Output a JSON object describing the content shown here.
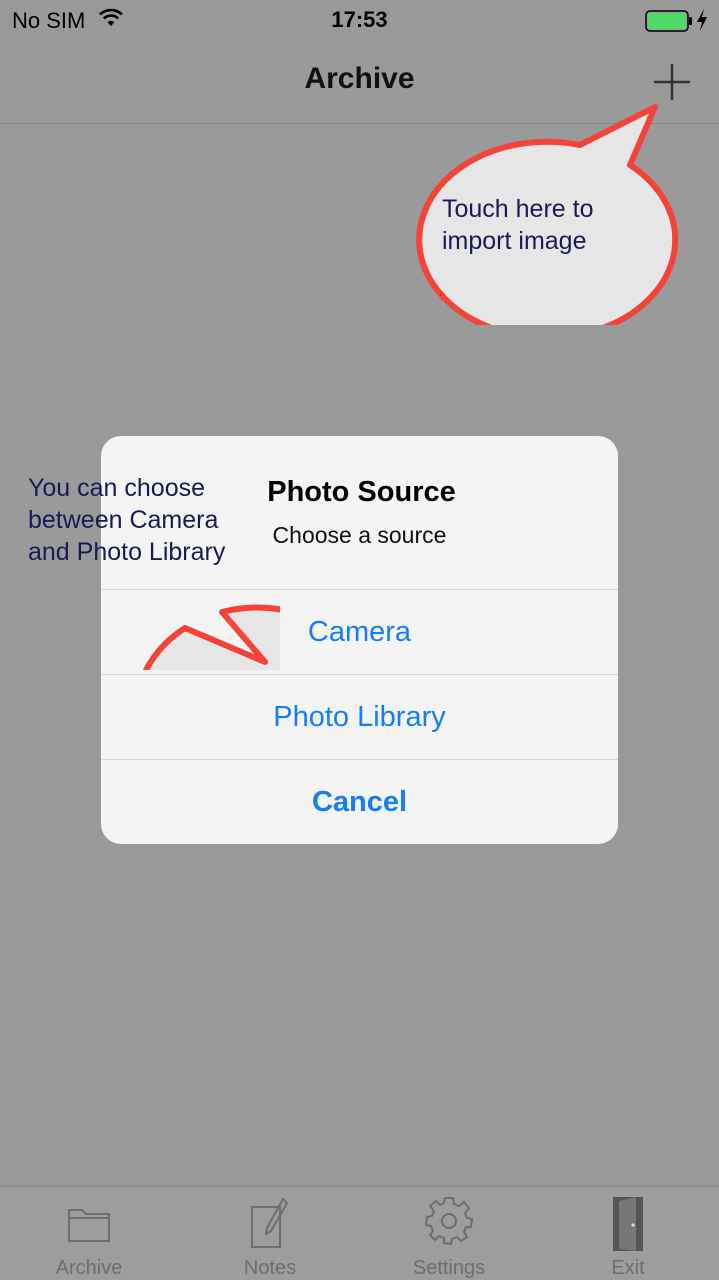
{
  "status_bar": {
    "carrier": "No SIM",
    "time": "17:53",
    "wifi_icon": "wifi-icon",
    "battery_icon": "battery-charging-icon",
    "battery_color": "#4cd964"
  },
  "nav": {
    "title": "Archive",
    "add_icon": "plus-icon"
  },
  "callouts": {
    "import_hint": "Touch here to import image",
    "source_hint": "You can choose between Camera and Photo Library",
    "border_color": "#f5433a",
    "fill_color": "#e6e6e6"
  },
  "alert": {
    "title": "Photo Source",
    "message": "Choose a source",
    "buttons": {
      "camera": "Camera",
      "library": "Photo Library",
      "cancel": "Cancel"
    },
    "accent": "#157efb"
  },
  "tabs": [
    {
      "label": "Archive",
      "icon": "folder-icon"
    },
    {
      "label": "Notes",
      "icon": "note-pencil-icon"
    },
    {
      "label": "Settings",
      "icon": "gear-icon"
    },
    {
      "label": "Exit",
      "icon": "door-icon"
    }
  ]
}
